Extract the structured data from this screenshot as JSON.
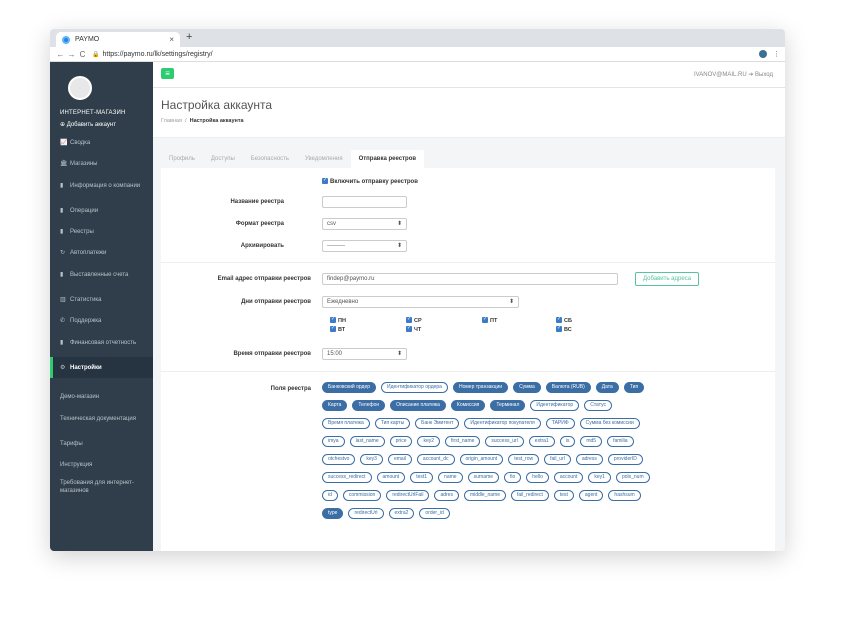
{
  "browser": {
    "tab_title": "PAYMO",
    "tab_close": "×",
    "new_tab": "+",
    "back": "←",
    "forward": "→",
    "reload": "C",
    "url": "https://paymo.ru/lk/settings/registry/",
    "menu": "⋮"
  },
  "sidebar": {
    "shop_name": "ИНТЕРНЕТ-МАГАЗИН",
    "add_account": "Добавить аккаунт",
    "items": [
      {
        "icon": "chart-icon",
        "glyph": "📈",
        "label": "Сводка"
      },
      {
        "icon": "bank-icon",
        "glyph": "🏛",
        "label": "Магазины"
      },
      {
        "icon": "document-icon",
        "glyph": "▮",
        "label": "Информация о компании"
      },
      {
        "icon": "copy-icon",
        "glyph": "▮",
        "label": "Операции"
      },
      {
        "icon": "copy-icon",
        "glyph": "▮",
        "label": "Реестры"
      },
      {
        "icon": "history-icon",
        "glyph": "↻",
        "label": "Автоплатежи"
      },
      {
        "icon": "copy-icon",
        "glyph": "▮",
        "label": "Выставленные счета"
      },
      {
        "icon": "bar-chart-icon",
        "glyph": "▥",
        "label": "Статистика"
      },
      {
        "icon": "phone-icon",
        "glyph": "✆",
        "label": "Поддержка"
      },
      {
        "icon": "document-icon",
        "glyph": "▮",
        "label": "Финансовая отчетность"
      },
      {
        "icon": "gear-icon",
        "glyph": "⚙",
        "label": "Настройки"
      }
    ],
    "links": [
      "Демо-магазин",
      "Техническая документация",
      "Тарифы",
      "Инструкция",
      "Требования для интернет-магазинов"
    ]
  },
  "topbar": {
    "menu_glyph": "≡",
    "user_email": "IVANOV@MAIL.RU",
    "logout": "Выход"
  },
  "page": {
    "title": "Настройка аккаунта",
    "breadcrumb_home": "Главная",
    "breadcrumb_sep": "/",
    "breadcrumb_current": "Настройка аккаунта"
  },
  "tabs": [
    "Профиль",
    "Доступы",
    "Безопасность",
    "Уведомления",
    "Отправка реестров"
  ],
  "form": {
    "enable_label": "Включить отправку реестров",
    "registry_name_label": "Название реестра",
    "registry_name_value": "",
    "format_label": "Формат реестра",
    "format_value": "csv",
    "archive_label": "Архивировать",
    "archive_value": "---------",
    "email_label": "Email адрес отправки реестров",
    "email_value": "findep@paymo.ru",
    "add_address_button": "Добавить адреса",
    "days_label": "Дни отправки реестров",
    "days_value": "Ежедневно",
    "days": [
      "ПН",
      "СР",
      "ПТ",
      "СБ",
      "ВТ",
      "ЧТ",
      "ВС"
    ],
    "time_label": "Время отправки реестров",
    "time_value": "15:00",
    "fields_label": "Поля реестра"
  },
  "fields": [
    {
      "label": "Банковский ордер",
      "on": true
    },
    {
      "label": "Идентификатор ордера",
      "on": false
    },
    {
      "label": "Номер транзакции",
      "on": true
    },
    {
      "label": "Сумма",
      "on": true
    },
    {
      "label": "Валюта (RUB)",
      "on": true
    },
    {
      "label": "Дата",
      "on": true
    },
    {
      "label": "Тип",
      "on": true
    },
    {
      "label": "Карта",
      "on": true
    },
    {
      "label": "Телефон",
      "on": true
    },
    {
      "label": "Описание платежа",
      "on": true
    },
    {
      "label": "Комиссия",
      "on": true
    },
    {
      "label": "Терминал",
      "on": true
    },
    {
      "label": "Идентификатор",
      "on": false
    },
    {
      "label": "Статус",
      "on": false
    },
    {
      "label": "Время платежа",
      "on": false
    },
    {
      "label": "Тип карты",
      "on": false
    },
    {
      "label": "Банк Эмитент",
      "on": false
    },
    {
      "label": "Идентификатор покупателя",
      "on": false
    },
    {
      "label": "ТАРИФ",
      "on": false
    },
    {
      "label": "Сумма без комиссии",
      "on": false
    },
    {
      "label": "imya",
      "on": false
    },
    {
      "label": "last_name",
      "on": false
    },
    {
      "label": "price",
      "on": false
    },
    {
      "label": "key2",
      "on": false
    },
    {
      "label": "first_name",
      "on": false
    },
    {
      "label": "success_url",
      "on": false
    },
    {
      "label": "extra1",
      "on": false
    },
    {
      "label": "is",
      "on": false
    },
    {
      "label": "md5",
      "on": false
    },
    {
      "label": "familia",
      "on": false
    },
    {
      "label": "otchestvo",
      "on": false
    },
    {
      "label": "key3",
      "on": false
    },
    {
      "label": "email",
      "on": false
    },
    {
      "label": "account_dc",
      "on": false
    },
    {
      "label": "origin_amount",
      "on": false
    },
    {
      "label": "test_row",
      "on": false
    },
    {
      "label": "fail_url",
      "on": false
    },
    {
      "label": "adress",
      "on": false
    },
    {
      "label": "providerID",
      "on": false
    },
    {
      "label": "success_redirect",
      "on": false
    },
    {
      "label": "amount",
      "on": false
    },
    {
      "label": "test1",
      "on": false
    },
    {
      "label": "name",
      "on": false
    },
    {
      "label": "surname",
      "on": false
    },
    {
      "label": "fio",
      "on": false
    },
    {
      "label": "hello",
      "on": false
    },
    {
      "label": "account",
      "on": false
    },
    {
      "label": "key1",
      "on": false
    },
    {
      "label": "pols_num",
      "on": false
    },
    {
      "label": "id",
      "on": false
    },
    {
      "label": "commission",
      "on": false
    },
    {
      "label": "redirectUrlFail",
      "on": false
    },
    {
      "label": "adres",
      "on": false
    },
    {
      "label": "middle_name",
      "on": false
    },
    {
      "label": "fail_redirect",
      "on": false
    },
    {
      "label": "test",
      "on": false
    },
    {
      "label": "agent",
      "on": false
    },
    {
      "label": "hashsum",
      "on": false
    },
    {
      "label": "type",
      "on": true
    },
    {
      "label": "redirectUrl",
      "on": false
    },
    {
      "label": "extra2",
      "on": false
    },
    {
      "label": "order_id",
      "on": false
    }
  ],
  "colors": {
    "accent": "#2ecc71",
    "sidebar": "#2f3e4a",
    "chip": "#3b6ea5",
    "checkbox": "#3b7bc8",
    "outline_button": "#58c3a0"
  }
}
